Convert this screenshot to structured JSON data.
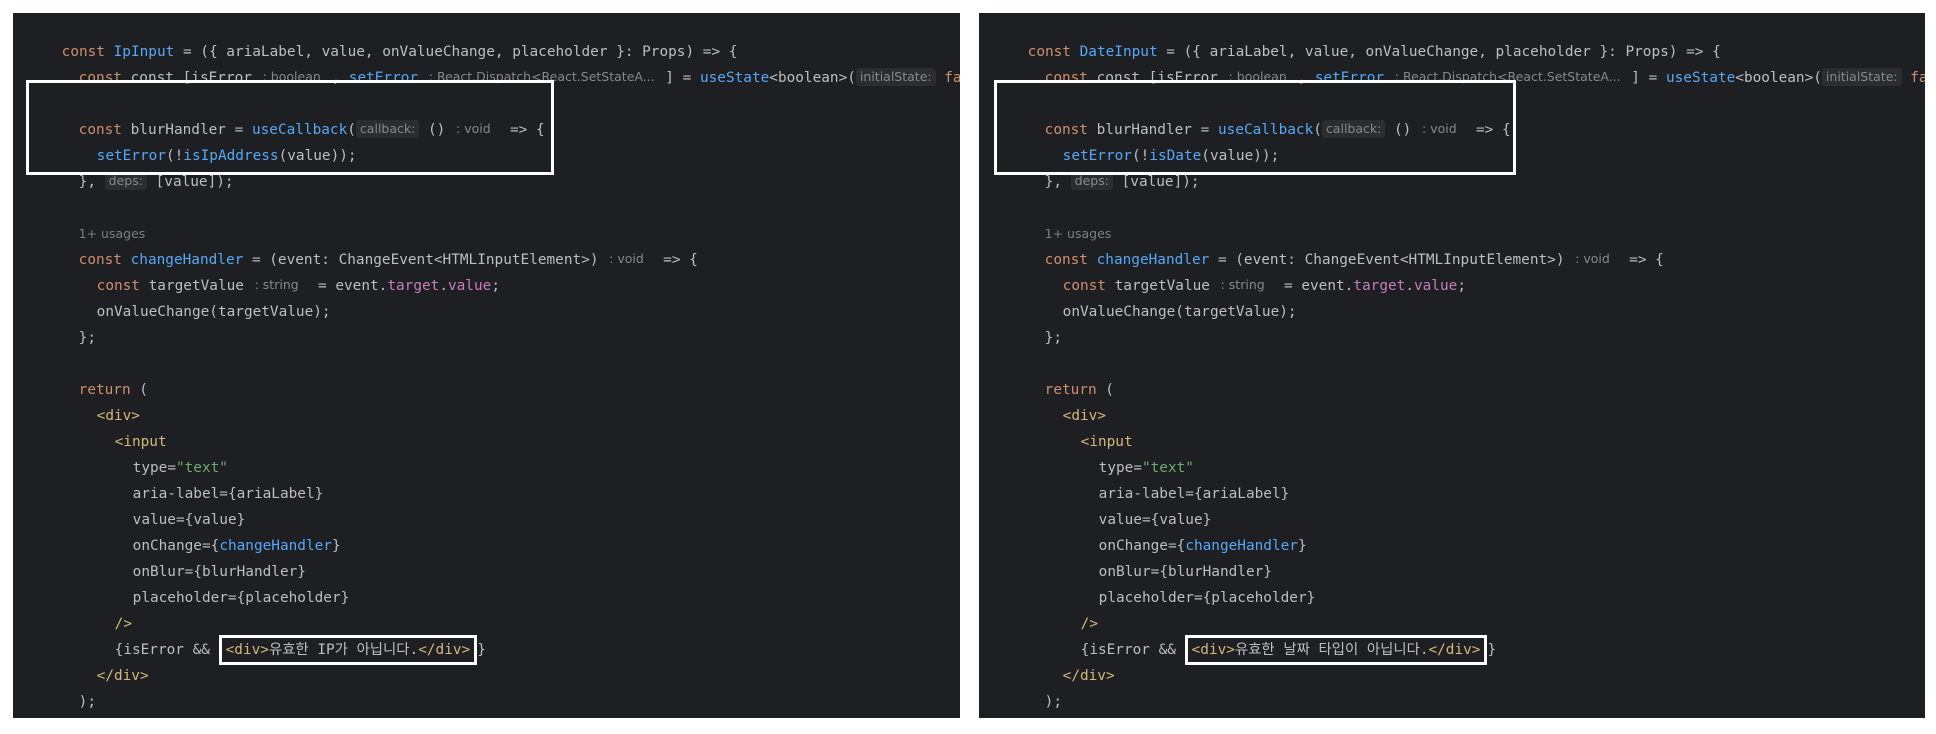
{
  "panels": [
    {
      "component_name": "IpInput",
      "validator_name": "isIpAddress",
      "error_message": "유효한 IP가 아닙니다."
    },
    {
      "component_name": "DateInput",
      "validator_name": "isDate",
      "error_message": "유효한 날짜 타입이 아닙니다."
    }
  ],
  "common": {
    "kw_const": "const ",
    "sig_rest": " = ({ ariaLabel, value, onValueChange, placeholder }: Props) => {",
    "state_open": "const [isError ",
    "hint_boolean": ": boolean",
    "comma": " , ",
    "set_error": "setError",
    "hint_dispatch": ": React.Dispatch<React.SetStateA...",
    "state_mid": " ] = ",
    "use_state": "useState",
    "generic": "<boolean>(",
    "hint_initial": "initialState:",
    "false_kw": " false",
    "state_end": ");",
    "blur_decl": "const ",
    "blur_name": "blurHandler",
    "eq": " = ",
    "use_callback": "useCallback",
    "paren_open": "(",
    "hint_callback": "callback:",
    "arrow_open": " ()",
    "hint_void": ": void",
    "arrow_rest": "  => {",
    "set_error_call_open": "(!",
    "set_error_call_close": "(value));",
    "deps_open": "},",
    "hint_deps": "deps:",
    "deps_rest": " [value]);",
    "usages": "1+ usages",
    "change_name": "changeHandler",
    "change_sig": " = (event: ChangeEvent<HTMLInputElement>)",
    "target_decl": "const ",
    "target_name": "targetValue ",
    "hint_string": ": string",
    "target_rest_a": "  = event.",
    "target_prop_target": "target",
    "dot": ".",
    "target_prop_value": "value",
    "semi": ";",
    "on_value_change_call": "onValueChange(targetValue);",
    "close_brace_semi": "};",
    "return_kw": "return",
    "return_paren": " (",
    "div_open": "<div>",
    "input_open": "<input",
    "attr_type": "type",
    "attr_eq": "=",
    "attr_type_val": "\"text\"",
    "attr_aria": "aria-label",
    "attr_aria_val": "{ariaLabel}",
    "attr_value": "value",
    "attr_value_val": "{value}",
    "attr_onchange": "onChange",
    "brace_open": "{",
    "brace_close": "}",
    "attr_onblur": "onBlur",
    "attr_onblur_val": "{blurHandler}",
    "attr_placeholder": "placeholder",
    "attr_placeholder_val": "{placeholder}",
    "self_close": "/>",
    "is_error_and": "{isError && ",
    "inner_div_open": "<div>",
    "inner_div_close": "</div>",
    "close_curly": "}",
    "div_close": "</div>",
    "return_close": ");",
    "final_close": "};"
  }
}
